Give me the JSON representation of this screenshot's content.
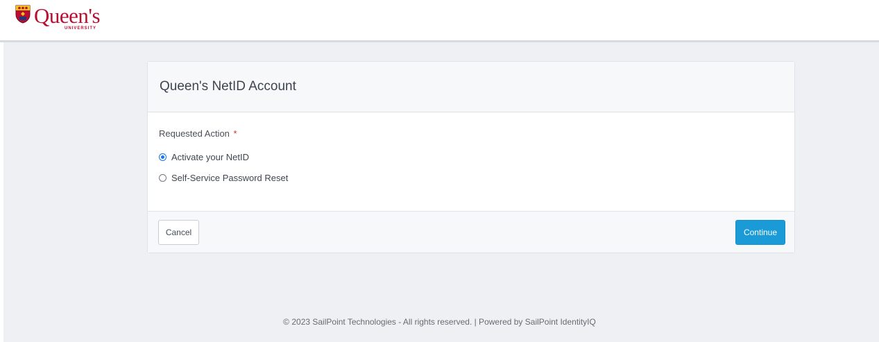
{
  "header": {
    "logo_word": "Queen's",
    "logo_sub": "UNIVERSITY",
    "brand_color": "#b90e31"
  },
  "form": {
    "title": "Queen's NetID Account",
    "field_label": "Requested Action",
    "required_mark": "*",
    "options": [
      {
        "label": "Activate your NetID",
        "selected": true
      },
      {
        "label": "Self-Service Password Reset",
        "selected": false
      }
    ],
    "cancel_label": "Cancel",
    "continue_label": "Continue",
    "accent_color": "#1a9bd7"
  },
  "footer": {
    "text": "© 2023 SailPoint Technologies - All rights reserved. | Powered by SailPoint IdentityIQ"
  }
}
